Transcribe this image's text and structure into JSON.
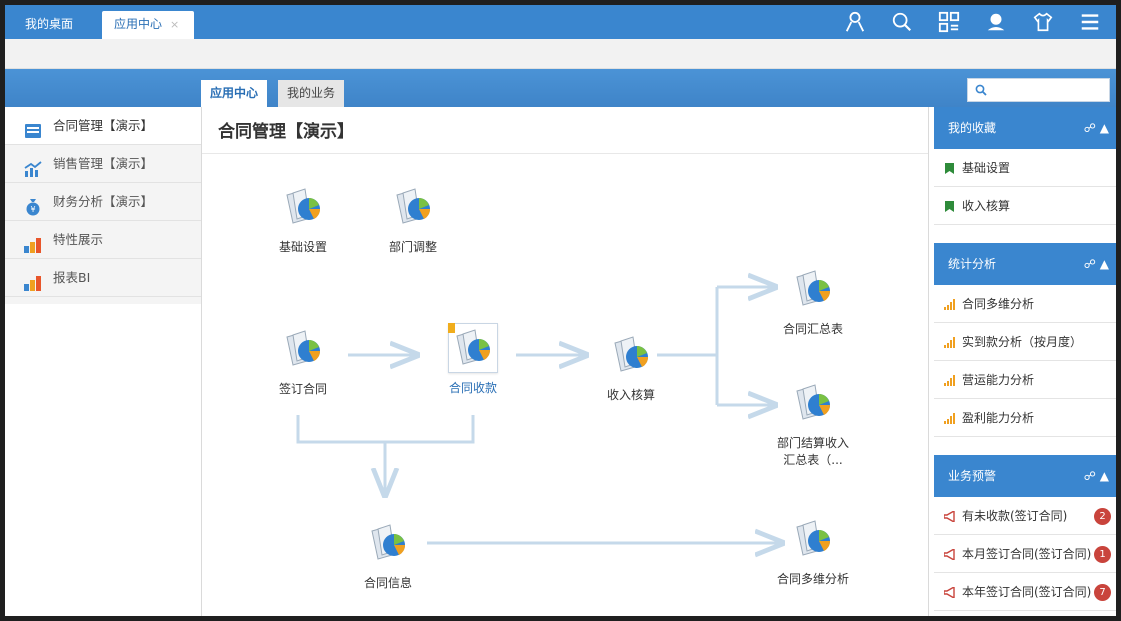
{
  "tabs": {
    "desk": "我的桌面",
    "app": "应用中心",
    "close": "×"
  },
  "top_icons": [
    "user-icon",
    "search-icon",
    "apps-grid-icon",
    "chat-user-icon",
    "shirt-icon",
    "menu-icon"
  ],
  "subtabs": {
    "active": "应用中心",
    "other": "我的业务"
  },
  "search": {
    "placeholder": ""
  },
  "sidebar": {
    "items": [
      {
        "label": "合同管理【演示】",
        "icon": "inbox-icon"
      },
      {
        "label": "销售管理【演示】",
        "icon": "trend-chart-icon"
      },
      {
        "label": "财务分析【演示】",
        "icon": "money-bag-icon"
      },
      {
        "label": "特性展示",
        "icon": "bar-chart-icon"
      },
      {
        "label": "报表BI",
        "icon": "bar-chart-icon"
      }
    ]
  },
  "main": {
    "title": "合同管理【演示】",
    "nodes": {
      "basic": "基础设置",
      "dept": "部门调整",
      "sign": "签订合同",
      "collect": "合同收款",
      "income": "收入核算",
      "summary": "合同汇总表",
      "dept_income": "部门结算收入汇总表（...",
      "info": "合同信息",
      "multi": "合同多维分析"
    }
  },
  "right": {
    "favorites": {
      "title": "我的收藏",
      "items": [
        "基础设置",
        "收入核算"
      ]
    },
    "stats": {
      "title": "统计分析",
      "items": [
        "合同多维分析",
        "实到款分析（按月度）",
        "营运能力分析",
        "盈利能力分析"
      ]
    },
    "alerts": {
      "title": "业务预警",
      "items": [
        {
          "label": "有未收款(签订合同)",
          "count": "2"
        },
        {
          "label": "本月签订合同(签订合同)",
          "count": "1"
        },
        {
          "label": "本年签订合同(签订合同)",
          "count": "7"
        }
      ]
    },
    "header_icons": "☍ ▲"
  },
  "colors": {
    "brand_blue": "#3a86cf",
    "badge_red": "#c9443c",
    "bookmark_green": "#2e8b3a",
    "stats_orange": "#f0a020"
  }
}
